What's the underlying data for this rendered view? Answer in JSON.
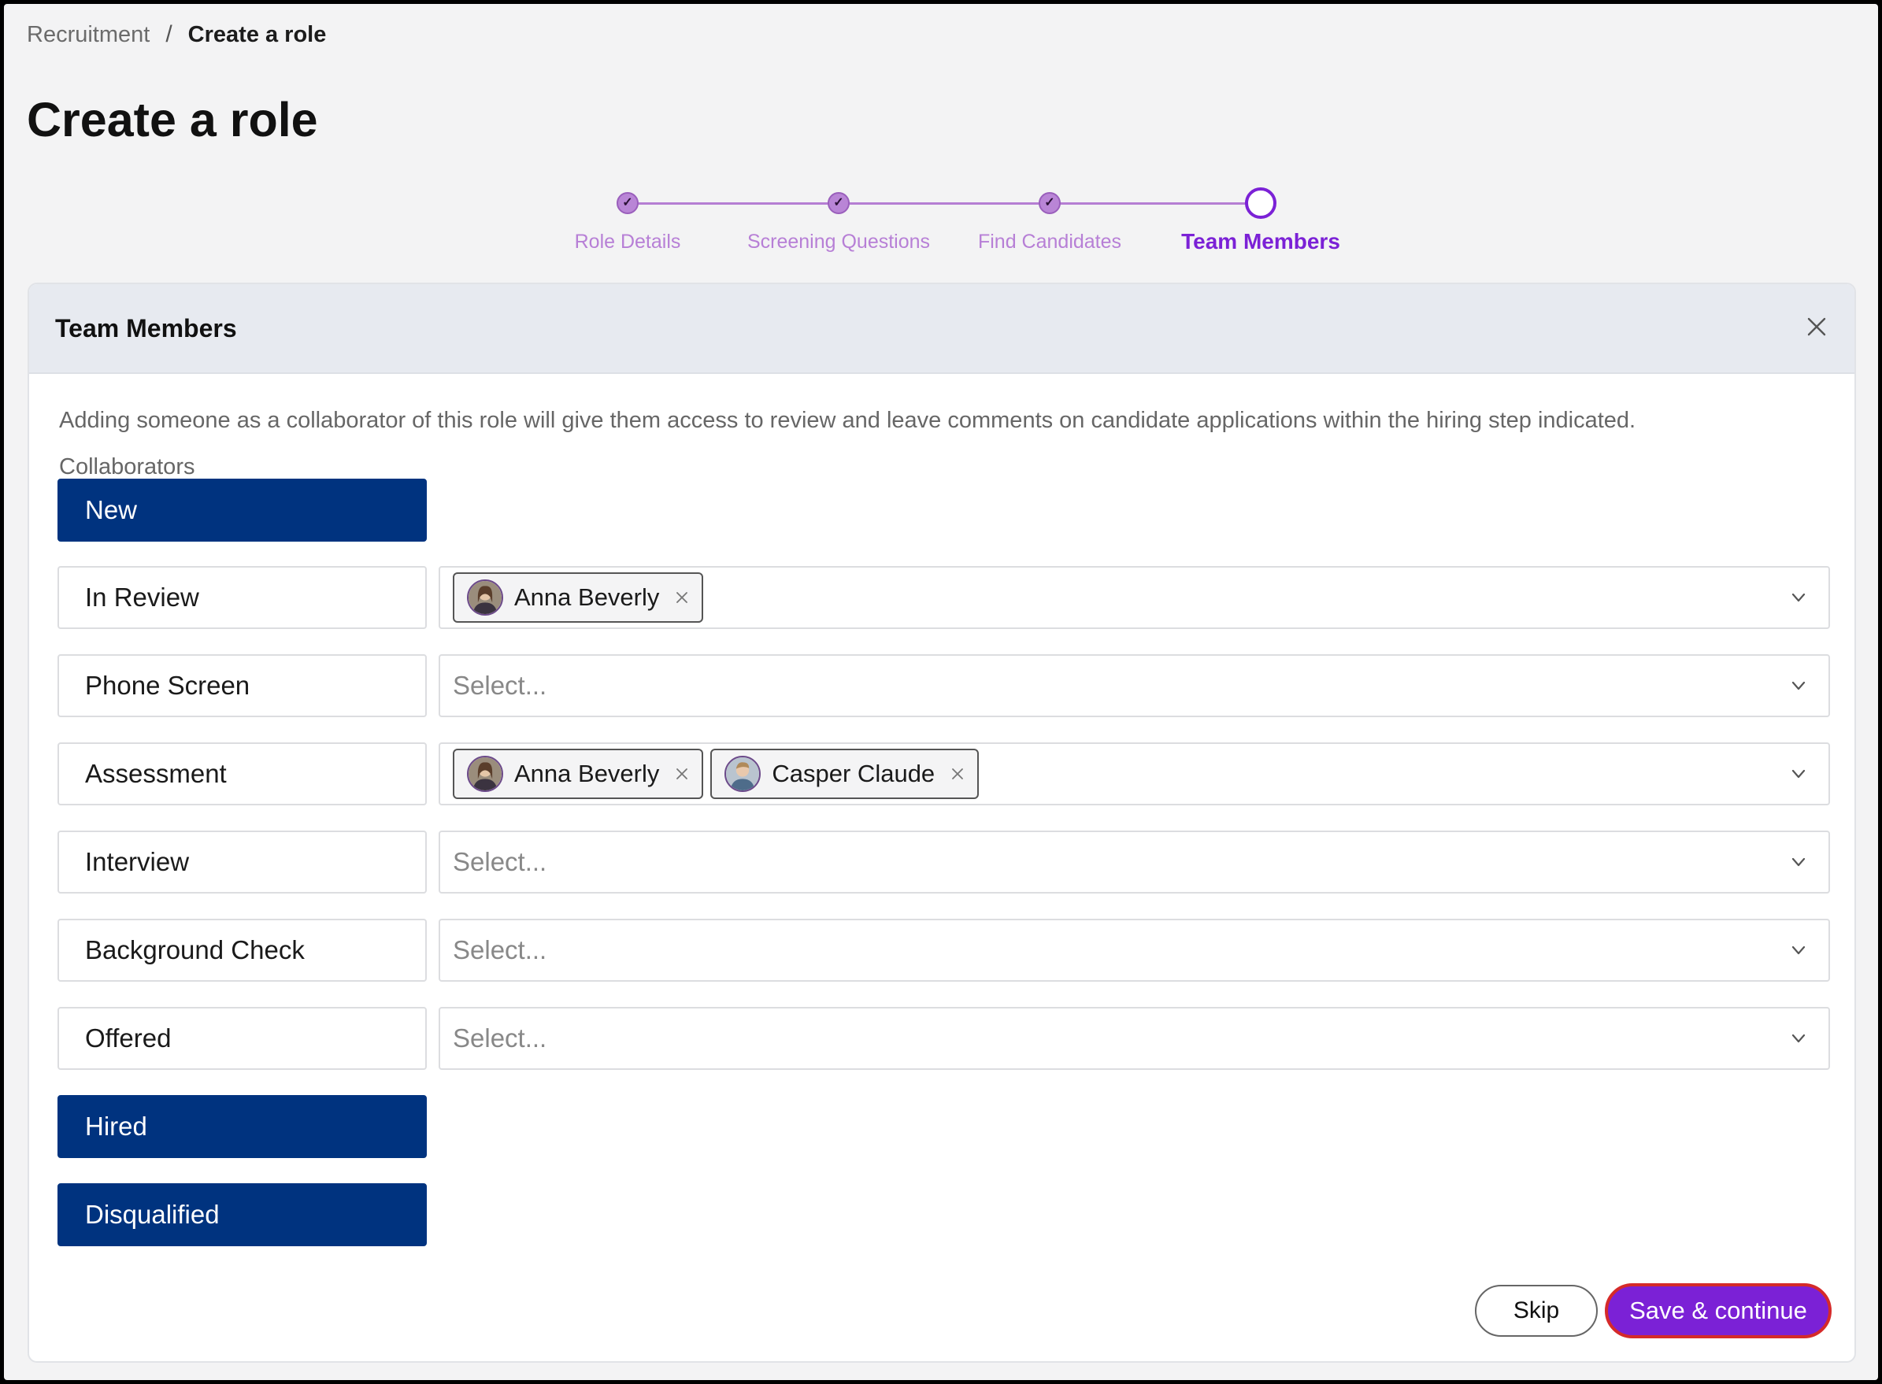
{
  "breadcrumb": {
    "parent": "Recruitment",
    "separator": "/",
    "current": "Create a role"
  },
  "page": {
    "title": "Create a role"
  },
  "stepper": {
    "steps": [
      {
        "label": "Role Details",
        "state": "completed"
      },
      {
        "label": "Screening Questions",
        "state": "completed"
      },
      {
        "label": "Find Candidates",
        "state": "completed"
      },
      {
        "label": "Team Members",
        "state": "current"
      }
    ],
    "check_glyph": "✓"
  },
  "panel": {
    "title": "Team Members",
    "close_icon": "close-icon",
    "intro": "Adding someone as a collaborator of this role will give them access to review and leave comments on candidate applications within the hiring step indicated.",
    "section_label": "Collaborators",
    "stages": [
      {
        "label": "New",
        "style": "filled"
      },
      {
        "label": "In Review",
        "style": "outline",
        "placeholder": "Select...",
        "collaborators": [
          "Anna Beverly"
        ]
      },
      {
        "label": "Phone Screen",
        "style": "outline",
        "placeholder": "Select...",
        "collaborators": []
      },
      {
        "label": "Assessment",
        "style": "outline",
        "placeholder": "Select...",
        "collaborators": [
          "Anna Beverly",
          "Casper Claude"
        ]
      },
      {
        "label": "Interview",
        "style": "outline",
        "placeholder": "Select...",
        "collaborators": []
      },
      {
        "label": "Background Check",
        "style": "outline",
        "placeholder": "Select...",
        "collaborators": []
      },
      {
        "label": "Offered",
        "style": "outline",
        "placeholder": "Select...",
        "collaborators": []
      },
      {
        "label": "Hired",
        "style": "filled"
      },
      {
        "label": "Disqualified",
        "style": "filled"
      }
    ]
  },
  "actions": {
    "skip_label": "Skip",
    "save_label": "Save & continue"
  },
  "colors": {
    "accent": "#7b21d6",
    "stage_filled": "#00337f",
    "step_completed": "#b985d6",
    "save_border": "#d52a2a"
  }
}
